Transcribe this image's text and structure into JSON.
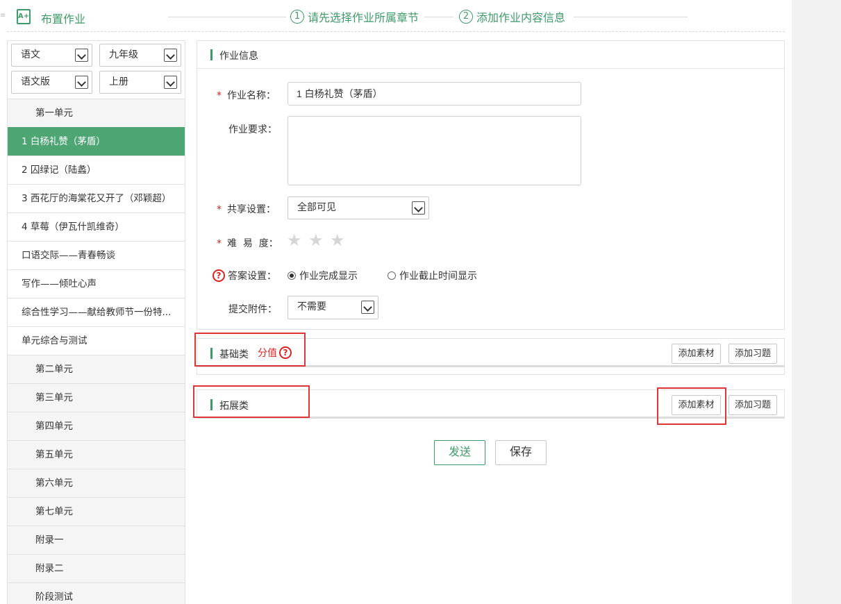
{
  "header": {
    "icon_text": "A+",
    "title": "布置作业",
    "step1_num": "1",
    "step1": "请先选择作业所属章节",
    "step2_num": "2",
    "step2": "添加作业内容信息"
  },
  "filters": {
    "subject": "语文",
    "grade": "九年级",
    "edition": "语文版",
    "volume": "上册"
  },
  "nav": {
    "items": [
      {
        "label": "第一单元",
        "type": "unit"
      },
      {
        "label": "1 白杨礼赞（茅盾）",
        "type": "active"
      },
      {
        "label": "2 囚绿记（陆蠡）",
        "type": "lesson"
      },
      {
        "label": "3 西花厅的海棠花又开了（邓颖超）",
        "type": "lesson"
      },
      {
        "label": "4 草莓（伊瓦什凯维奇）",
        "type": "lesson"
      },
      {
        "label": "口语交际——青春畅谈",
        "type": "lesson"
      },
      {
        "label": "写作——倾吐心声",
        "type": "lesson"
      },
      {
        "label": "综合性学习——献给教师节一份特...",
        "type": "lesson"
      },
      {
        "label": "单元综合与测试",
        "type": "lesson"
      },
      {
        "label": "第二单元",
        "type": "unit"
      },
      {
        "label": "第三单元",
        "type": "unit"
      },
      {
        "label": "第四单元",
        "type": "unit"
      },
      {
        "label": "第五单元",
        "type": "unit"
      },
      {
        "label": "第六单元",
        "type": "unit"
      },
      {
        "label": "第七单元",
        "type": "unit"
      },
      {
        "label": "附录一",
        "type": "unit"
      },
      {
        "label": "附录二",
        "type": "unit"
      },
      {
        "label": "阶段测试",
        "type": "unit"
      }
    ]
  },
  "info": {
    "panel_title": "作业信息",
    "name_label": "作业名称：",
    "name_value": "1 白杨礼赞（茅盾）",
    "req_label": "作业要求：",
    "req_value": "",
    "share_label": "共享设置：",
    "share_value": "全部可见",
    "difficulty_label": "难  易  度：",
    "difficulty_stars": 0,
    "difficulty_max": 3,
    "answer_label": "答案设置：",
    "answer_option1": "作业完成显示",
    "answer_option2": "作业截止时间显示",
    "attach_label": "提交附件：",
    "attach_value": "不需要"
  },
  "basic": {
    "title": "基础类",
    "score_label": "分值",
    "add_material": "添加素材",
    "add_exercise": "添加习题"
  },
  "extend": {
    "title": "拓展类",
    "add_material": "添加素材",
    "add_exercise": "添加习题"
  },
  "actions": {
    "send": "发送",
    "save": "保存"
  },
  "colors": {
    "accent": "#3f9a6a",
    "active_bg": "#4ea574",
    "required": "#dd2222",
    "highlight_box": "#e03535"
  }
}
